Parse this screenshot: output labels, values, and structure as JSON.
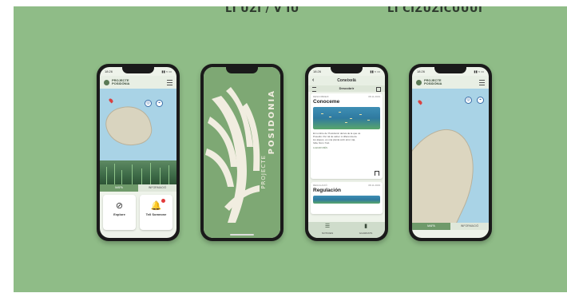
{
  "header": {
    "left_text": "LI UZI / V IU",
    "right_text": "LI CIZUZICUUUI"
  },
  "phones": {
    "home": {
      "status_time": "18:26",
      "status_icons": "▮▮ ≈ ▭",
      "logo_line1": "PROJECTE",
      "logo_line2": "POSIDÒNIA",
      "tab_active": "MAPA",
      "tab_other": "INFORMACIÓ",
      "button_left": "Explore",
      "button_right": "Tell Someone",
      "icons": {
        "left": "compass-icon",
        "right": "bell-icon"
      }
    },
    "splash": {
      "title": "POSIDONIA",
      "subtitle": "PROJECTE"
    },
    "articles": {
      "status_time": "18:26",
      "status_icons": "▮▮ ≈ ▭",
      "nav_title": "Coneixelà",
      "subheader": "Descobrir",
      "card1": {
        "category": "DESCOBREIX",
        "date": "08.11.2019",
        "title": "Conoceme",
        "text": "El nombre de 'Posidonia' deriva de la que va\nPoseidó. Per tal de saber. A diferencia de\nles algues, es una planta amb arrel, tija,\nfulla, flors i fruit.",
        "more": "LLEGIR MÉS"
      },
      "card2": {
        "category": "REGULACIÓ",
        "date": "08.11.2019",
        "title": "Regulación"
      },
      "bottom_nav": [
        "NOTICIES",
        "GUARDATS"
      ]
    },
    "map": {
      "status_time": "18:26",
      "status_icons": "▮▮ ≈ ▭",
      "logo_line1": "PROJECTE",
      "logo_line2": "POSIDÒNIA",
      "tab_active": "MAPA",
      "tab_other": "INFORMACIÓ"
    }
  },
  "colors": {
    "background": "#8fbc87",
    "accent": "#6f9a6a",
    "splash": "#7ea874"
  }
}
